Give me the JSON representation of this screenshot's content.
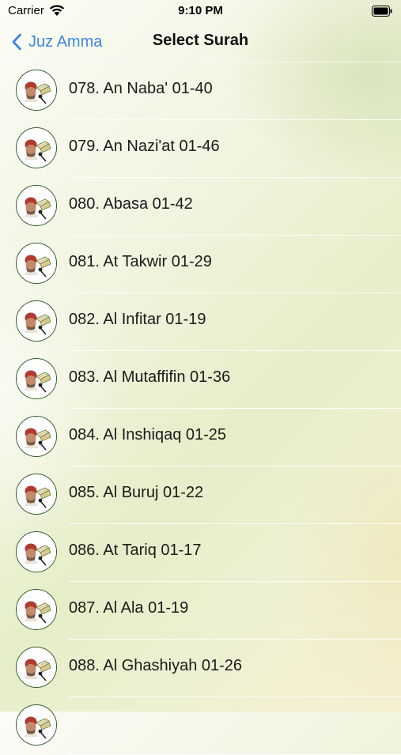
{
  "status_bar": {
    "carrier": "Carrier",
    "time": "9:10 PM"
  },
  "nav": {
    "back_label": "Juz Amma",
    "title": "Select Surah"
  },
  "surahs": [
    {
      "label": "078. An Naba' 01-40"
    },
    {
      "label": "079. An Nazi'at 01-46"
    },
    {
      "label": "080. Abasa 01-42"
    },
    {
      "label": "081. At Takwir 01-29"
    },
    {
      "label": "082. Al Infitar 01-19"
    },
    {
      "label": "083. Al Mutaffifin 01-36"
    },
    {
      "label": "084. Al Inshiqaq 01-25"
    },
    {
      "label": "085. Al Buruj 01-22"
    },
    {
      "label": "086. At Tariq 01-17"
    },
    {
      "label": "087. Al Ala 01-19"
    },
    {
      "label": "088. Al Ghashiyah 01-26"
    },
    {
      "label": ""
    }
  ],
  "colors": {
    "accent": "#3d86e0",
    "thumb_border": "#2f5a2a"
  },
  "icons": {
    "row_thumbnail": "reciter-with-quran-icon"
  }
}
